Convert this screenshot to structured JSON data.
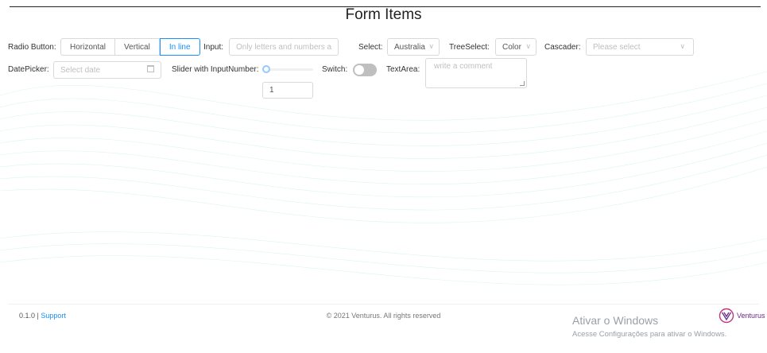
{
  "page": {
    "title": "Form Items"
  },
  "form": {
    "radio_label": "Radio Button",
    "radio_options": [
      "Horizontal",
      "Vertical",
      "In line"
    ],
    "radio_selected": "In line",
    "input_label": "Input",
    "input_placeholder": "Only letters and numbers a",
    "select_label": "Select",
    "select_value": "Australia",
    "treeselect_label": "TreeSelect",
    "treeselect_value": "Color",
    "cascader_label": "Cascader",
    "cascader_placeholder": "Please select",
    "datepicker_label": "DatePicker",
    "datepicker_placeholder": "Select date",
    "slider_label": "Slider with InputNumber",
    "slider_value": "1",
    "switch_label": "Switch",
    "switch_on": false,
    "textarea_label": "TextArea",
    "textarea_placeholder": "write a comment",
    "colon": ":"
  },
  "footer": {
    "version": "0.1.0 | ",
    "support": "Support",
    "copyright": "© 2021 Venturus. All rights reserved",
    "brand": "Venturus"
  },
  "watermark": {
    "line1": "Ativar o Windows",
    "line2": "Acesse Configurações para ativar o Windows."
  },
  "icons": {
    "select_arrow": "chevron-down-icon",
    "date": "calendar-icon",
    "logo": "venturus-logo-icon"
  },
  "colors": {
    "primary": "#1890ff",
    "border": "#d9d9d9",
    "placeholder": "#bfbfbf",
    "brand": "#6a2a8a"
  }
}
